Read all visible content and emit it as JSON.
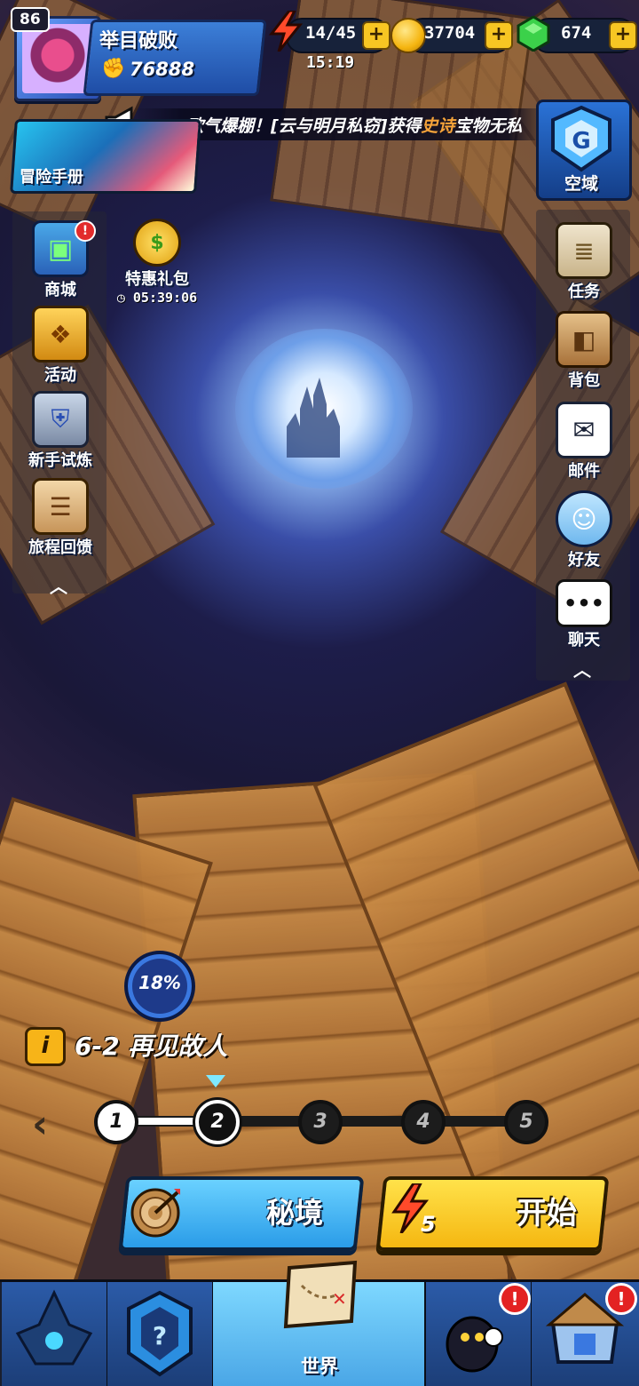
{
  "player": {
    "level": "86",
    "name": "举目破败",
    "power": "76888"
  },
  "resources": {
    "energy": "14/45",
    "energy_timer": "15:19",
    "coins": "37704",
    "gems": "674",
    "plus": "+"
  },
  "announcement": {
    "prefix": "欧气爆棚！[云与明月私窃]获得",
    "highlight": "史诗",
    "suffix": "宝物无私"
  },
  "banner": {
    "manual_label": "冒险手册",
    "sky_label": "空域"
  },
  "left_menu": [
    {
      "label": "商城",
      "icon": "treasure-chest-icon",
      "alert": "!"
    },
    {
      "label": "活动",
      "icon": "gift-box-icon"
    },
    {
      "label": "新手试炼",
      "icon": "shield-book-icon"
    },
    {
      "label": "旅程回馈",
      "icon": "clipboard-icon"
    }
  ],
  "special_gift": {
    "label": "特惠礼包",
    "timer": "05:39:06"
  },
  "right_menu": [
    {
      "label": "任务",
      "icon": "scroll-icon"
    },
    {
      "label": "背包",
      "icon": "backpack-icon"
    },
    {
      "label": "邮件",
      "icon": "mail-icon"
    },
    {
      "label": "好友",
      "icon": "friends-icon"
    },
    {
      "label": "聊天",
      "icon": "chat-icon"
    }
  ],
  "stage": {
    "progress": "18%",
    "info_icon": "i",
    "title": "6-2 再见故人",
    "nodes": [
      "1",
      "2",
      "3",
      "4",
      "5"
    ],
    "current": 2
  },
  "actions": {
    "secret_label": "秘境",
    "start_label": "开始",
    "start_cost": "5"
  },
  "bottom_nav": {
    "active_label": "世界",
    "alert": "!"
  },
  "colors": {
    "accent_blue": "#2a9ce8",
    "accent_yellow": "#f5b711",
    "alert_red": "#e22b2b"
  }
}
